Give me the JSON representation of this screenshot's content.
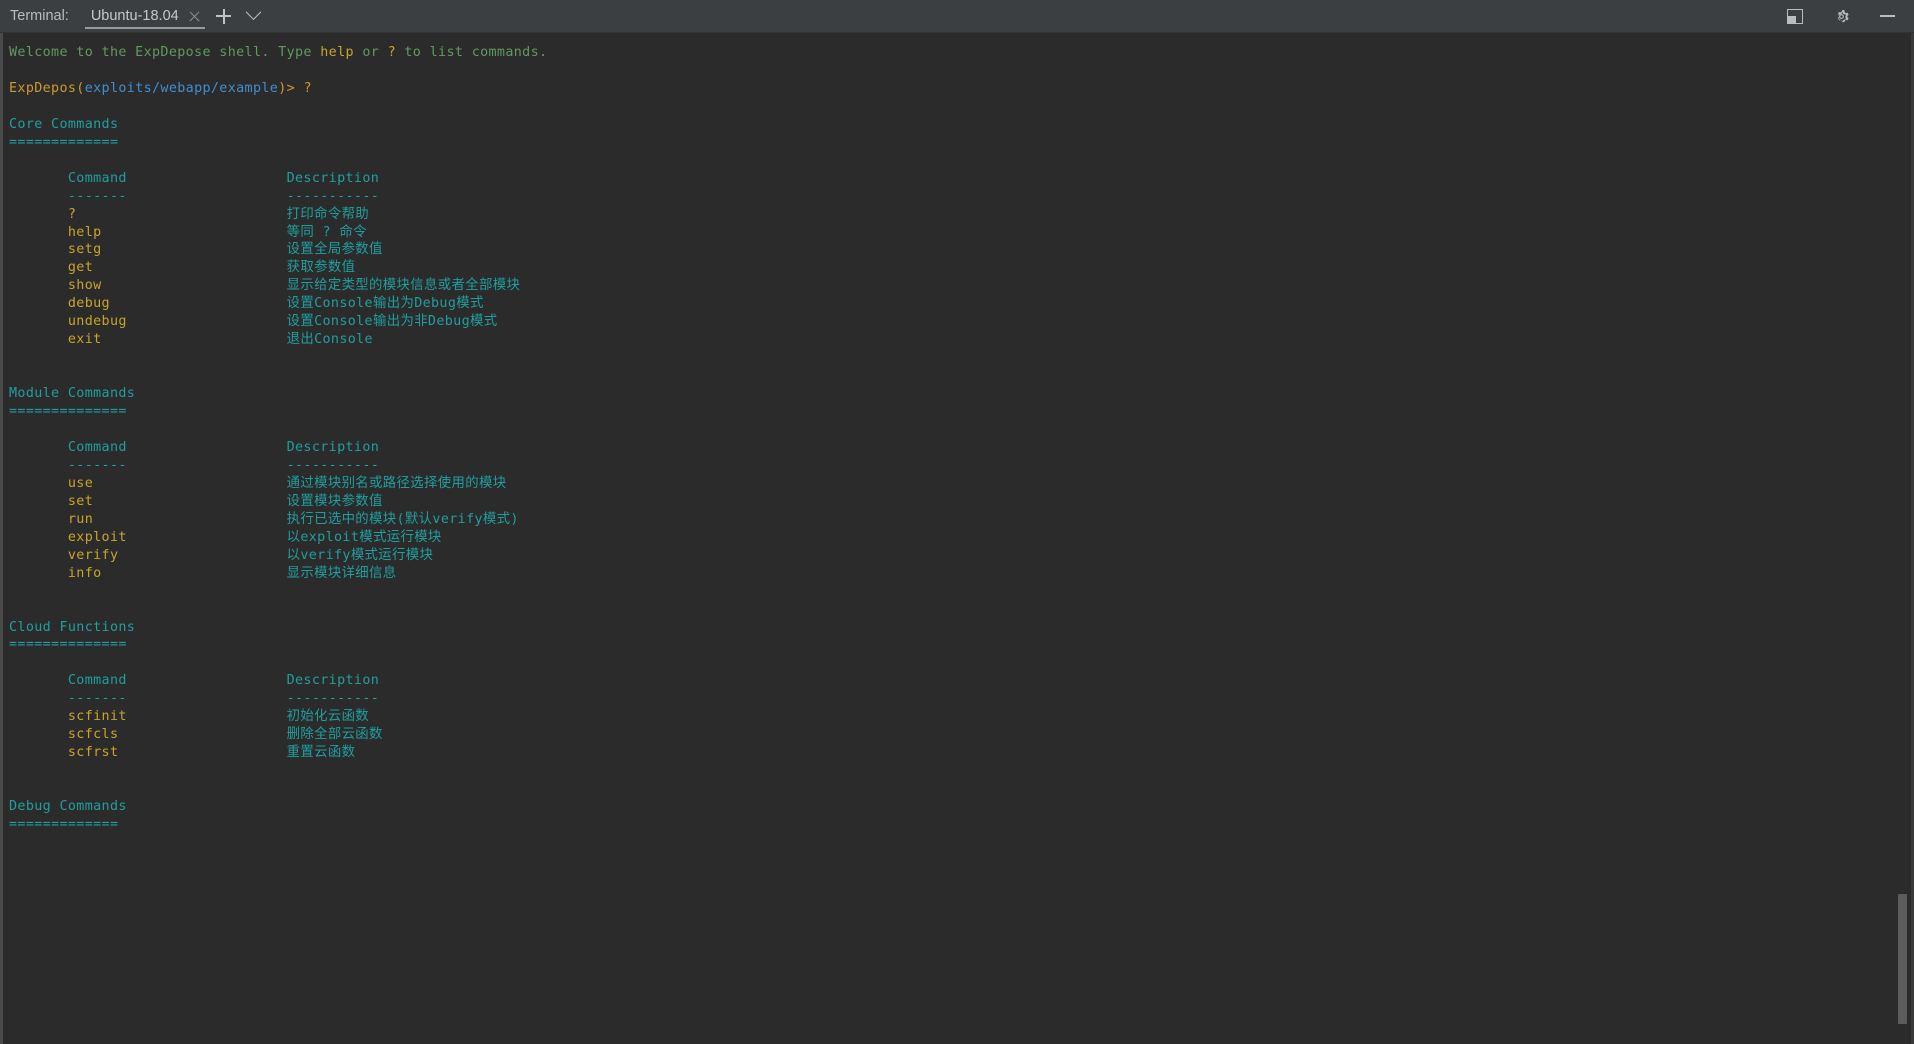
{
  "window": {
    "tool_label": "Terminal:",
    "tabs": [
      {
        "title": "Ubuntu-18.04",
        "active": true,
        "close_icon": "close-icon"
      }
    ],
    "new_tab_icon": "plus-icon",
    "tab_list_icon": "chevron-down-icon",
    "right_icons": [
      "split-pane-icon",
      "gear-icon",
      "minimize-icon"
    ]
  },
  "terminal": {
    "welcome": {
      "prefix": "Welcome to the ExpDepose shell. Type ",
      "help_kw": "help",
      "middle": " or ",
      "question_kw": "?",
      "suffix": " to list commands."
    },
    "prompt": {
      "app": "ExpDepos(",
      "path": "exploits/webapp/example",
      "close": ")> ",
      "input": "?"
    },
    "table_headers": {
      "command": "Command",
      "description": "Description",
      "command_rule": "-------",
      "description_rule": "-----------"
    },
    "sections": [
      {
        "title": "Core Commands",
        "rule": "=============",
        "rows": [
          {
            "command": "?",
            "description": "打印命令帮助"
          },
          {
            "command": "help",
            "description": "等同 ? 命令"
          },
          {
            "command": "setg",
            "description": "设置全局参数值"
          },
          {
            "command": "get",
            "description": "获取参数值"
          },
          {
            "command": "show",
            "description": "显示给定类型的模块信息或者全部模块"
          },
          {
            "command": "debug",
            "description": "设置Console输出为Debug模式"
          },
          {
            "command": "undebug",
            "description": "设置Console输出为非Debug模式"
          },
          {
            "command": "exit",
            "description": "退出Console"
          }
        ]
      },
      {
        "title": "Module Commands",
        "rule": "==============",
        "rows": [
          {
            "command": "use",
            "description": "通过模块别名或路径选择使用的模块"
          },
          {
            "command": "set",
            "description": "设置模块参数值"
          },
          {
            "command": "run",
            "description": "执行已选中的模块(默认verify模式)"
          },
          {
            "command": "exploit",
            "description": "以exploit模式运行模块"
          },
          {
            "command": "verify",
            "description": "以verify模式运行模块"
          },
          {
            "command": "info",
            "description": "显示模块详细信息"
          }
        ]
      },
      {
        "title": "Cloud Functions",
        "rule": "==============",
        "rows": [
          {
            "command": "scfinit",
            "description": "初始化云函数"
          },
          {
            "command": "scfcls",
            "description": "删除全部云函数"
          },
          {
            "command": "scfrst",
            "description": "重置云函数"
          }
        ]
      },
      {
        "title": "Debug Commands",
        "rule": "=============",
        "rows": []
      }
    ]
  },
  "colors": {
    "green": "#5f9a5f",
    "yellow": "#c9a429",
    "blue": "#3f8fd0",
    "cyan": "#1f9f9f",
    "background": "#2b2b2b",
    "header_background": "#3c3f41"
  }
}
